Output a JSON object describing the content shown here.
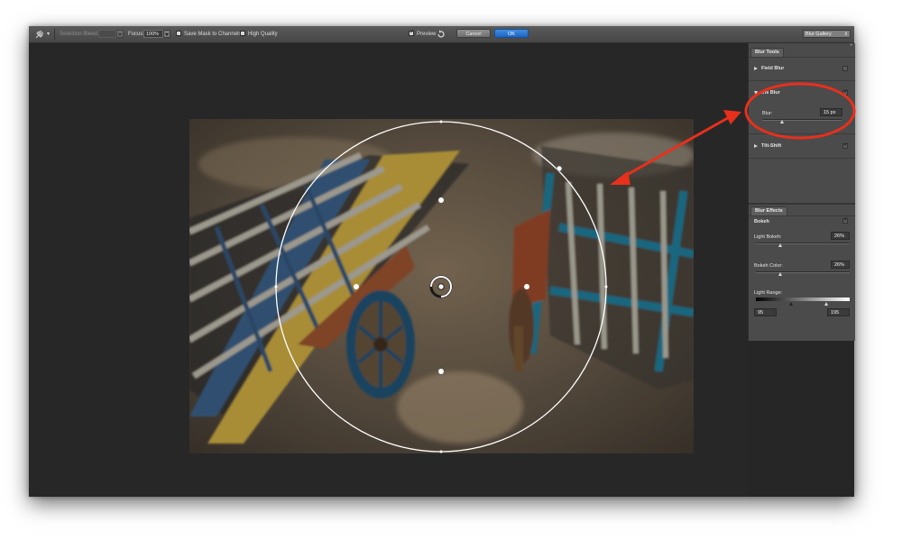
{
  "options_bar": {
    "selection_bleed_label": "Selection Bleed:",
    "selection_bleed_value": "",
    "focus_label": "Focus:",
    "focus_value": "100%",
    "save_mask_label": "Save Mask to Channels",
    "high_quality_label": "High Quality",
    "preview_label": "Preview",
    "preview_checked": true,
    "cancel_label": "Cancel",
    "ok_label": "OK",
    "gallery_select": "Blur Gallery"
  },
  "blur_tools": {
    "tab_label": "Blur Tools",
    "field_blur": {
      "label": "Field Blur",
      "checked": false
    },
    "iris_blur": {
      "label": "Iris Blur",
      "checked": true,
      "blur_label": "Blur:",
      "blur_value": "15 px",
      "slider_fraction": 0.25
    },
    "tilt_shift": {
      "label": "Tilt-Shift",
      "checked": true
    }
  },
  "blur_effects": {
    "tab_label": "Blur Effects",
    "bokeh_label": "Bokeh",
    "bokeh_checked": true,
    "light_bokeh_label": "Light Bokeh:",
    "light_bokeh_value": "26%",
    "light_bokeh_fraction": 0.26,
    "bokeh_color_label": "Bokeh Color:",
    "bokeh_color_value": "26%",
    "bokeh_color_fraction": 0.26,
    "light_range_label": "Light Range:",
    "light_range_low": "95",
    "light_range_high": "195"
  },
  "colors": {
    "annotation": "#e8301c",
    "ok_button": "#2a72d0",
    "panel": "#4b4b4b",
    "canvas": "#272727"
  }
}
